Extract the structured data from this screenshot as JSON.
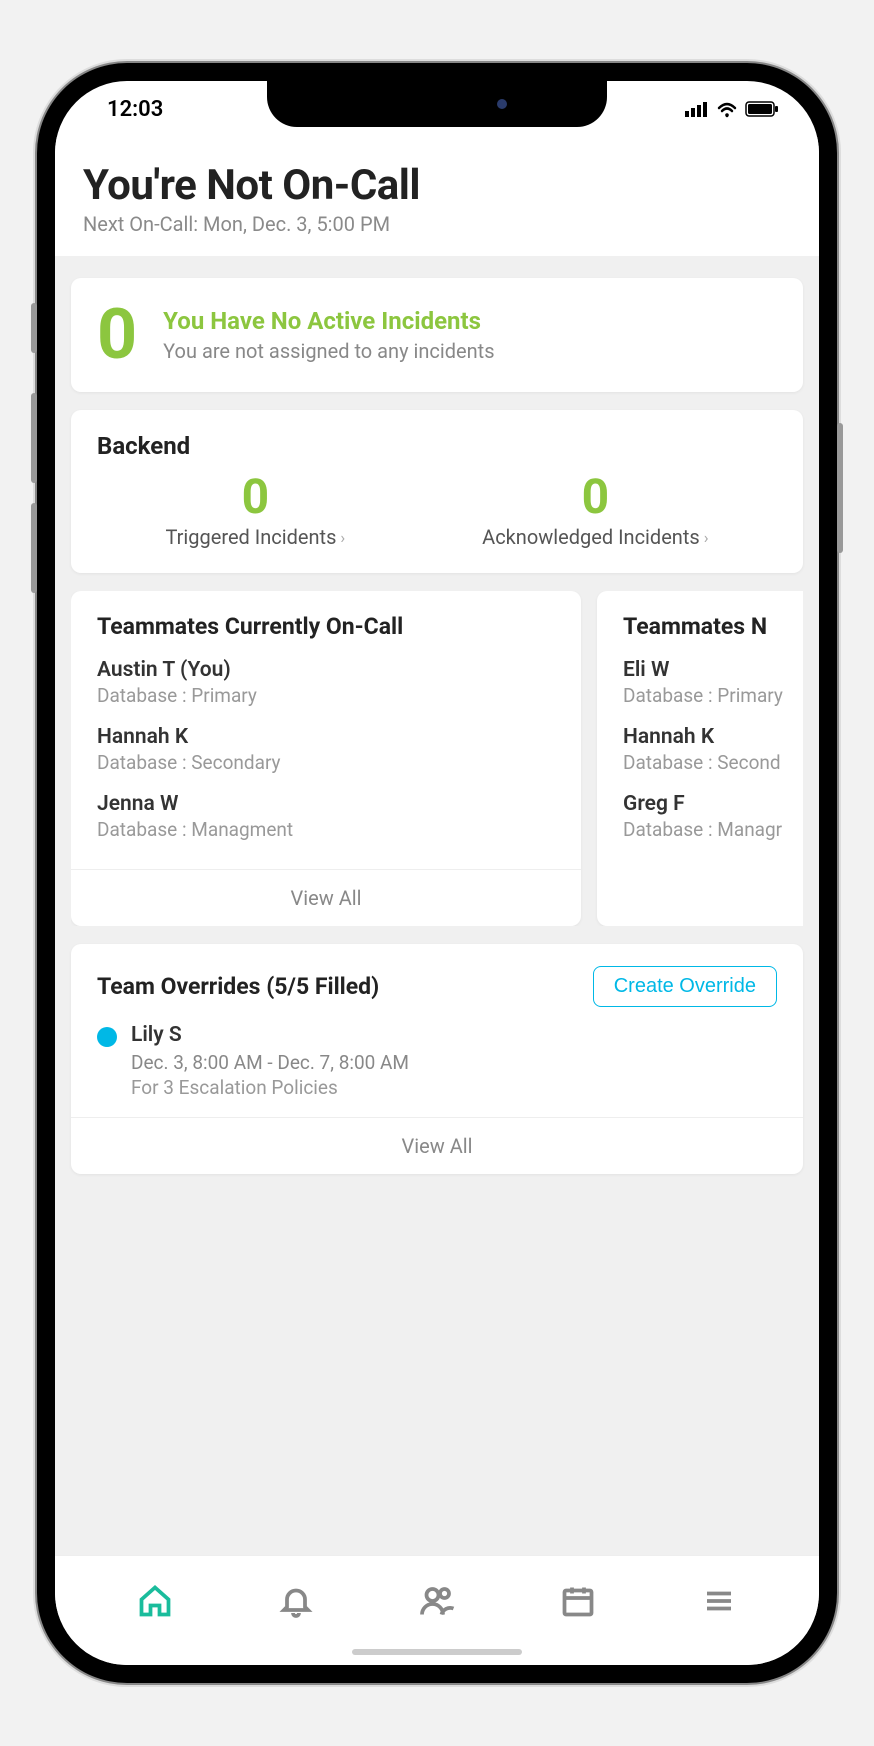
{
  "status_bar": {
    "time": "12:03"
  },
  "header": {
    "title": "You're Not On-Call",
    "subtitle": "Next On-Call: Mon, Dec. 3, 5:00 PM"
  },
  "incidents": {
    "count": "0",
    "title": "You Have No Active Incidents",
    "subtitle": "You are not assigned to any incidents"
  },
  "backend": {
    "title": "Backend",
    "triggered": {
      "count": "0",
      "label": "Triggered Incidents"
    },
    "acknowledged": {
      "count": "0",
      "label": "Acknowledged Incidents"
    }
  },
  "team_current": {
    "title": "Teammates Currently On-Call",
    "members": [
      {
        "name": "Austin T (You)",
        "role": "Database : Primary"
      },
      {
        "name": "Hannah K",
        "role": "Database : Secondary"
      },
      {
        "name": "Jenna W",
        "role": "Database : Managment"
      }
    ],
    "view_all": "View All"
  },
  "team_next": {
    "title": "Teammates N",
    "members": [
      {
        "name": "Eli W",
        "role": "Database : Primary"
      },
      {
        "name": "Hannah K",
        "role": "Database : Second"
      },
      {
        "name": "Greg F",
        "role": "Database : Managr"
      }
    ]
  },
  "overrides": {
    "title": "Team Overrides (5/5 Filled)",
    "create_button": "Create Override",
    "items": [
      {
        "name": "Lily S",
        "dates": "Dec. 3, 8:00 AM - Dec. 7, 8:00 AM",
        "for": "For 3 Escalation Policies"
      }
    ],
    "view_all": "View All"
  }
}
